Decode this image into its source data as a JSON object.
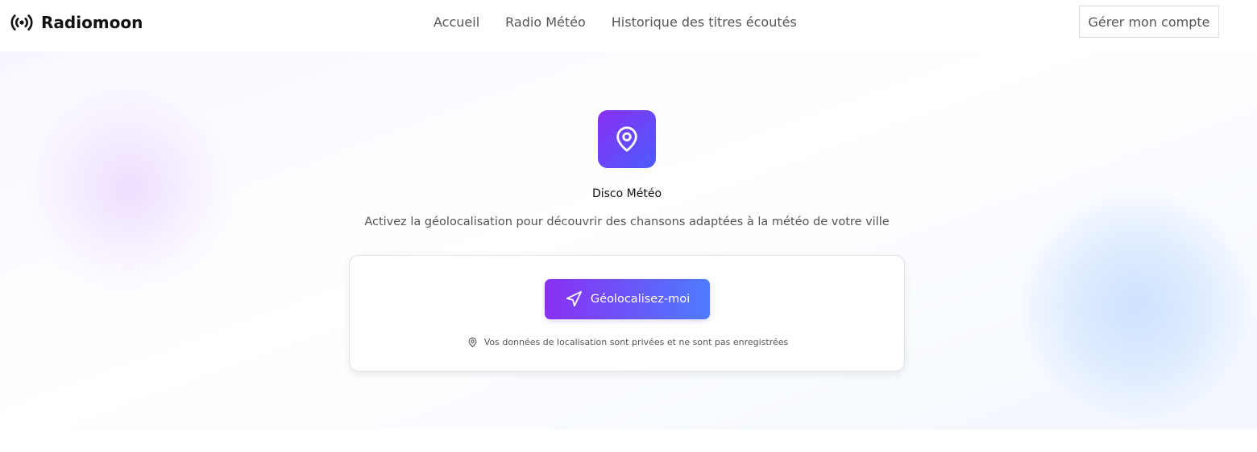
{
  "brand": {
    "name": "Radiomoon",
    "icon": "broadcast-icon"
  },
  "nav": {
    "items": [
      {
        "label": "Accueil"
      },
      {
        "label": "Radio Météo"
      },
      {
        "label": "Historique des titres écoutés"
      }
    ]
  },
  "account": {
    "label": "Gérer mon compte"
  },
  "hero": {
    "icon": "map-pin-icon",
    "title": "Disco Météo",
    "subtitle": "Activez la géolocalisation pour découvrir des chansons adaptées à la météo de votre ville"
  },
  "card": {
    "button_label": "Géolocalisez-moi",
    "button_icon": "navigation-arrow-icon",
    "privacy_note": "Vos données de localisation sont privées et ne sont pas enregistrées",
    "privacy_icon": "map-pin-icon"
  },
  "colors": {
    "accent_start": "#8a2ff2",
    "accent_end": "#4d7cff"
  }
}
